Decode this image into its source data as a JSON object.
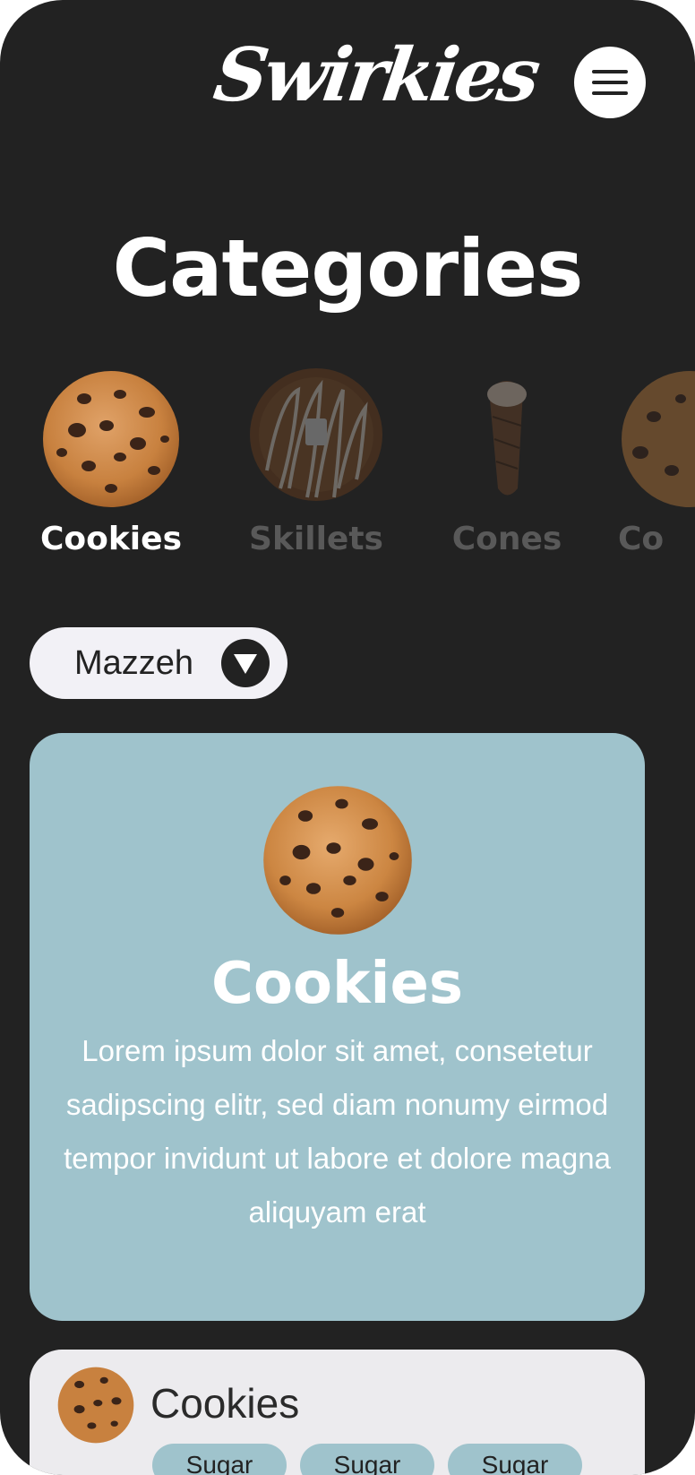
{
  "brand": {
    "logo_text": "Swirkies"
  },
  "header": {
    "menu_icon": "hamburger-menu-icon"
  },
  "page": {
    "title": "Categories"
  },
  "categories": [
    {
      "label": "Cookies",
      "icon": "cookie-image",
      "active": true,
      "color": "#ffffff"
    },
    {
      "label": "Skillets",
      "icon": "skillet-image",
      "active": false,
      "color": "#595959"
    },
    {
      "label": "Cones",
      "icon": "cone-image",
      "active": false,
      "color": "#595959"
    },
    {
      "label": "Co",
      "icon": "cookie-image",
      "active": false,
      "color": "#595959"
    }
  ],
  "filter": {
    "selected": "Mazzeh",
    "icon": "dropdown-triangle-icon"
  },
  "feature": {
    "title": "Cookies",
    "description": "Lorem ipsum dolor sit amet, consetetur sadipscing elitr, sed diam nonumy eirmod tempor invidunt ut labore et dolore magna aliquyam erat"
  },
  "product": {
    "title": "Cookies",
    "tags": [
      "Sugar",
      "Sugar",
      "Sugar"
    ]
  },
  "colors": {
    "background": "#222222",
    "accent": "#9fc3cc",
    "card_light": "#ecebee",
    "pill": "#f2f1f6"
  }
}
